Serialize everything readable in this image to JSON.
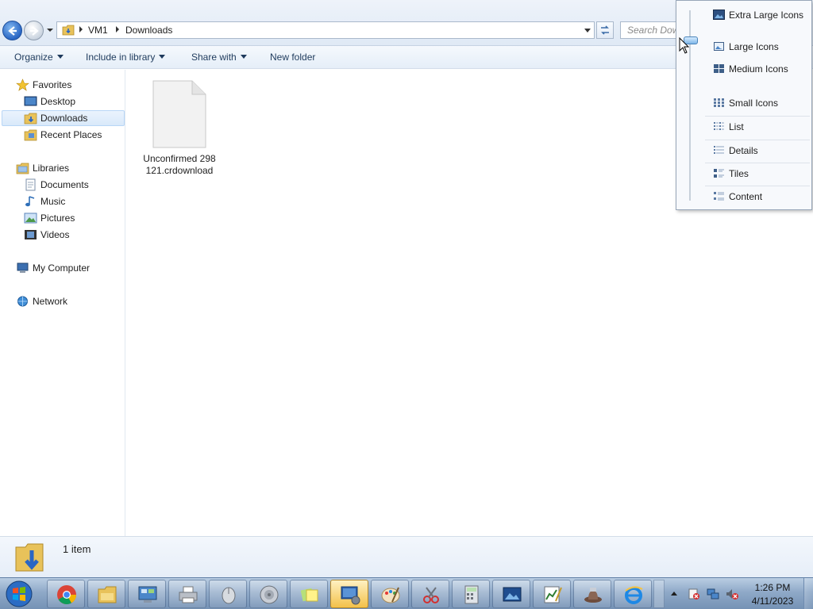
{
  "address": {
    "crumbs": [
      "VM1",
      "Downloads"
    ],
    "search_placeholder": "Search Dow"
  },
  "toolbar": {
    "organize": "Organize",
    "include_in_library": "Include in library",
    "share_with": "Share with",
    "new_folder": "New folder"
  },
  "nav": {
    "favorites": "Favorites",
    "desktop": "Desktop",
    "downloads": "Downloads",
    "recent_places": "Recent Places",
    "libraries": "Libraries",
    "documents": "Documents",
    "music": "Music",
    "pictures": "Pictures",
    "videos": "Videos",
    "my_computer": "My Computer",
    "network": "Network"
  },
  "content": {
    "files": [
      {
        "name": "Unconfirmed 298121.crdownload",
        "icon": "blank-file-icon"
      }
    ]
  },
  "details": {
    "count": "1 item"
  },
  "views_menu": {
    "items": [
      "Extra Large Icons",
      "Large Icons",
      "Medium Icons",
      "Small Icons",
      "List",
      "Details",
      "Tiles",
      "Content"
    ],
    "selected_level": "Large Icons"
  },
  "taskbar": {
    "apps": [
      "chrome-icon",
      "file-explorer-icon",
      "control-panel-icon",
      "printer-icon",
      "mouse-icon",
      "speaker-icon",
      "sticky-notes-icon",
      "remote-desktop-icon",
      "paint-icon",
      "snipping-tool-icon",
      "calculator-icon",
      "photo-viewer-icon",
      "chart-editor-icon",
      "hat-app-icon",
      "internet-explorer-icon"
    ],
    "time": "1:26 PM",
    "date": "4/11/2023"
  },
  "colors": {
    "accent": "#2a66c4",
    "selection": "#d9e9fa",
    "taskbar": "#8fa9c8",
    "folder": "#e8c25a"
  }
}
